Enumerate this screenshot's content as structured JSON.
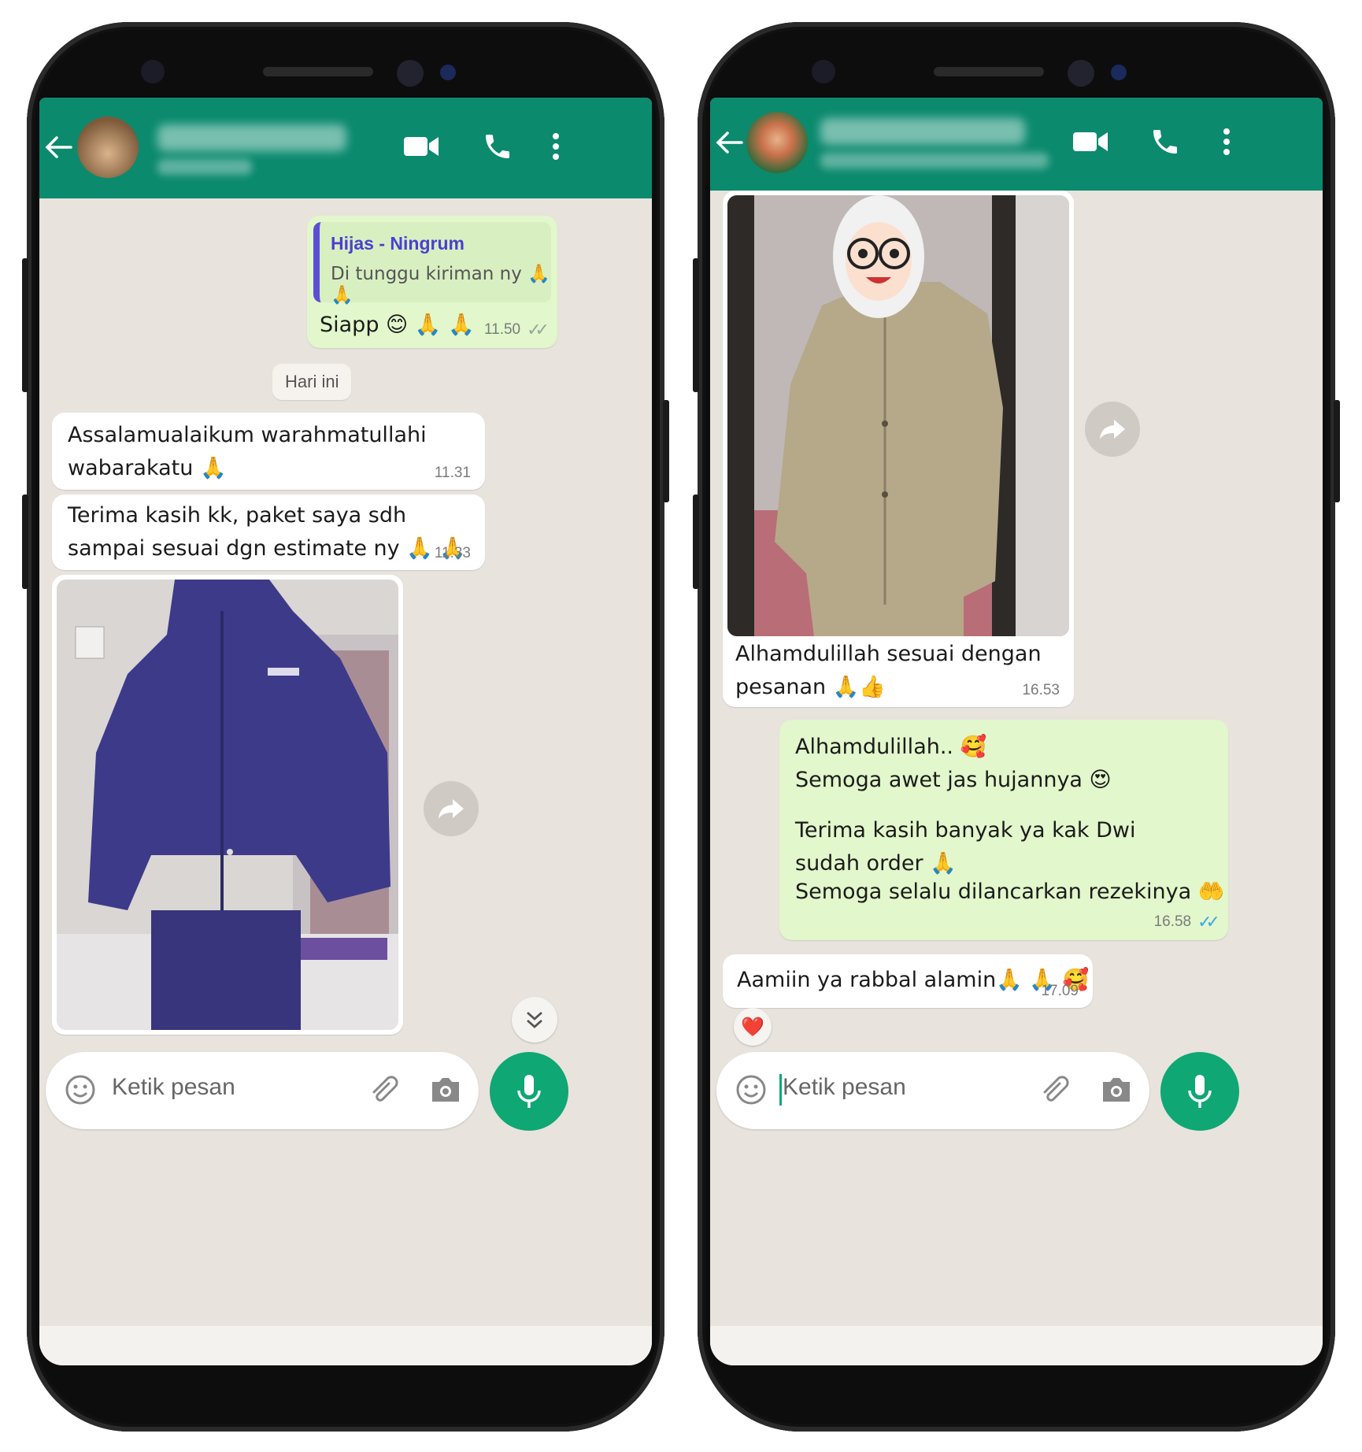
{
  "colors": {
    "header": "#0b8a6e",
    "incoming": "#ffffff",
    "outgoing": "#e2f7cb",
    "chat_bg": "#e8e3dc",
    "accent": "#0fa774",
    "quote_bar": "#5b4fd6"
  },
  "icons": {
    "back": "arrow-left",
    "video": "video-camera",
    "call": "phone",
    "menu": "dots-vertical",
    "emoji": "smiley",
    "attach": "paperclip",
    "camera": "camera",
    "mic": "microphone",
    "forward": "share-arrow",
    "scroll_down": "double-chevron-down"
  },
  "left_phone": {
    "quoted_name": "Hijas - Ningrum",
    "quoted_text": "Di tunggu kiriman ny 🙏 🙏",
    "reply_text": "Siapp 😊 🙏 🙏",
    "reply_time": "11.50",
    "date_chip": "Hari ini",
    "msg1_text": "Assalamualaikum warahmatullahi wabarakatu 🙏",
    "msg1_time": "11.31",
    "msg2_text": "Terima kasih kk, paket saya sdh sampai sesuai dgn estimate ny 🙏 🙏",
    "msg2_time": "11.33",
    "input_placeholder": "Ketik pesan"
  },
  "right_phone": {
    "photo_caption": "Alhamdulillah sesuai dengan pesanan 🙏👍",
    "photo_time": "16.53",
    "out_line1": "Alhamdulillah.. 🥰",
    "out_line2": "Semoga awet jas hujannya 😍",
    "out_line3": "Terima kasih banyak ya kak Dwi sudah order 🙏",
    "out_line4": "Semoga selalu dilancarkan rezekinya 🤲",
    "out_time": "16.58",
    "reply_text": "Aamiin ya rabbal alamin🙏 🙏 🥰",
    "reply_time": "17.09",
    "reaction": "❤️",
    "input_placeholder": "Ketik pesan"
  }
}
